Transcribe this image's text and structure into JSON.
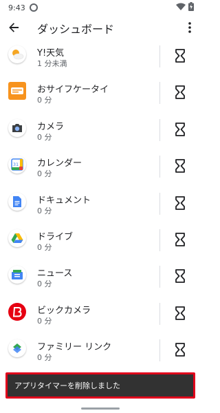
{
  "status": {
    "time": "9:43"
  },
  "header": {
    "title": "ダッシュボード"
  },
  "apps": [
    {
      "name": "Y!天気",
      "usage": "1 分未満",
      "icon": "sun-cloud-icon"
    },
    {
      "name": "おサイフケータイ",
      "usage": "0 分",
      "icon": "osaifu-icon"
    },
    {
      "name": "カメラ",
      "usage": "0 分",
      "icon": "camera-icon"
    },
    {
      "name": "カレンダー",
      "usage": "0 分",
      "icon": "calendar-icon",
      "icon_text": "31"
    },
    {
      "name": "ドキュメント",
      "usage": "0 分",
      "icon": "docs-icon"
    },
    {
      "name": "ドライブ",
      "usage": "0 分",
      "icon": "drive-icon"
    },
    {
      "name": "ニュース",
      "usage": "0 分",
      "icon": "news-icon"
    },
    {
      "name": "ビックカメラ",
      "usage": "0 分",
      "icon": "biccamera-icon"
    },
    {
      "name": "ファミリー リンク",
      "usage": "0 分",
      "icon": "family-link-icon"
    }
  ],
  "snackbar": {
    "message": "アプリタイマーを削除しました"
  },
  "colors": {
    "accent_border": "#e0001b",
    "snackbar_bg": "#323232"
  }
}
